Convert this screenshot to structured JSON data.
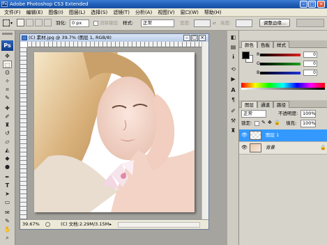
{
  "app": {
    "title": "Adobe Photoshop CS3 Extended",
    "logo": "Ps"
  },
  "menu": [
    "文件(F)",
    "编辑(E)",
    "图像(I)",
    "图层(L)",
    "选择(S)",
    "滤镜(T)",
    "分析(A)",
    "视图(V)",
    "窗口(W)",
    "帮助(H)"
  ],
  "options": {
    "feather_label": "羽化:",
    "feather_value": "0 px",
    "antialias_label": "消除锯齿",
    "style_label": "样式:",
    "style_value": "正常",
    "width_label": "宽度:",
    "height_label": "高度:",
    "refine_button": "调整边缘..."
  },
  "document": {
    "title": "(C) 素材.jpg @ 39.7% (图层 1, RGB/8)",
    "zoom": "39.67%",
    "status": "(C) 文档:2.29M/3.15M"
  },
  "color_panel": {
    "tabs": [
      "颜色",
      "色板",
      "样式"
    ],
    "channels": [
      {
        "label": "R",
        "value": "0",
        "color": "#e02020"
      },
      {
        "label": "G",
        "value": "0",
        "color": "#20a020"
      },
      {
        "label": "B",
        "value": "0",
        "color": "#2030e0"
      }
    ],
    "foreground": "#000000",
    "background": "#ffffff"
  },
  "layers_panel": {
    "tabs": [
      "图层",
      "通道",
      "路径"
    ],
    "blend_mode": "正常",
    "opacity_label": "不透明度:",
    "opacity_value": "100%",
    "lock_label": "锁定:",
    "fill_label": "填充:",
    "fill_value": "100%",
    "layers": [
      {
        "name": "图层 1",
        "selected": true
      },
      {
        "name": "背景",
        "selected": false
      }
    ]
  },
  "accent": "#3399ff"
}
